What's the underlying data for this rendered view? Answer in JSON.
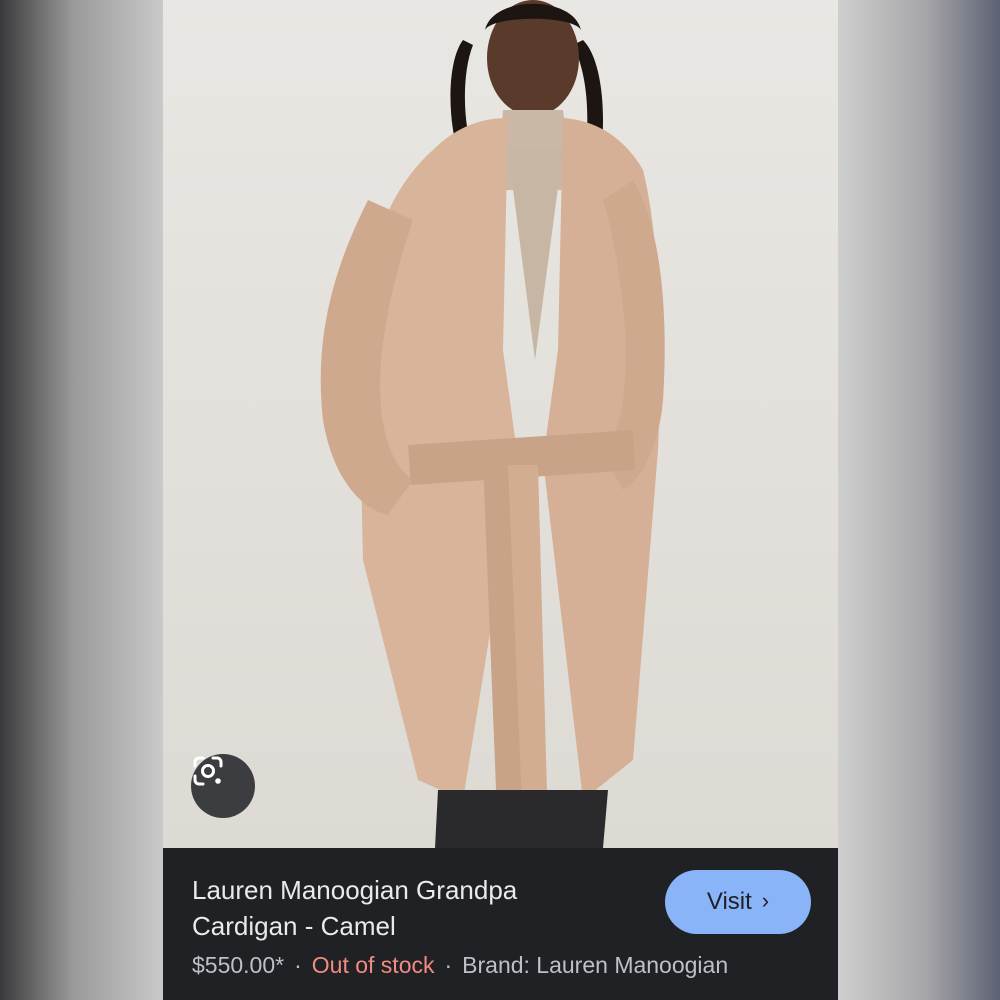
{
  "product": {
    "title": "Lauren Manoogian Grandpa Cardigan - Camel",
    "price": "$550.00*",
    "stock_status": "Out of stock",
    "separator": "·",
    "brand": "Brand: Lauren Manoogian"
  },
  "actions": {
    "visit_label": "Visit",
    "visit_chevron": "›",
    "lens_icon": "google-lens-icon"
  },
  "colors": {
    "panel_bg": "#202124",
    "visit_bg": "#8ab4f8",
    "out_of_stock": "#f28b82",
    "title_text": "#e8eaed",
    "meta_text": "#bdc1c6",
    "cardigan": "#d8b49a"
  }
}
